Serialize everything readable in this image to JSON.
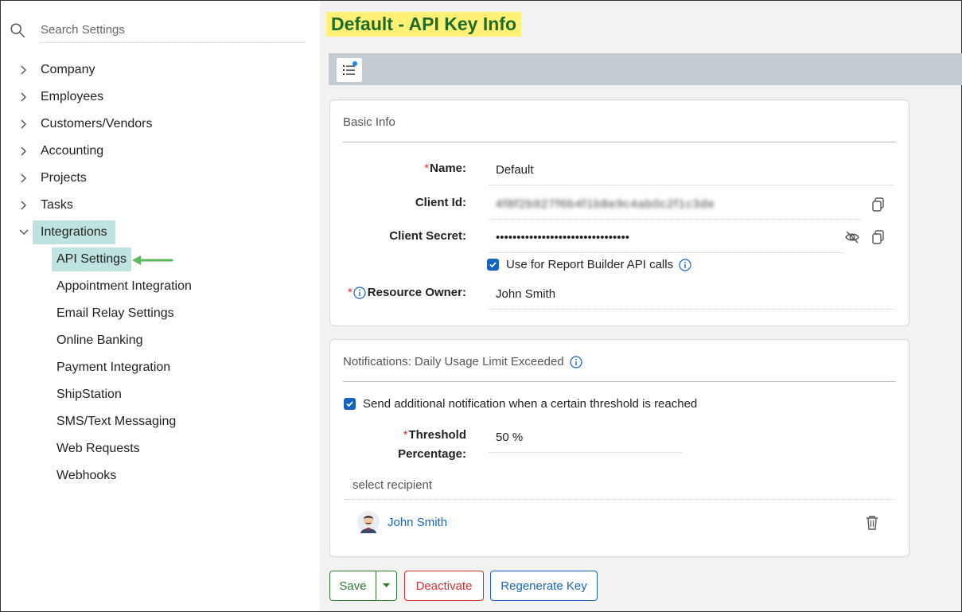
{
  "sidebar": {
    "search_placeholder": "Search Settings",
    "items": [
      {
        "label": "Company"
      },
      {
        "label": "Employees"
      },
      {
        "label": "Customers/Vendors"
      },
      {
        "label": "Accounting"
      },
      {
        "label": "Projects"
      },
      {
        "label": "Tasks"
      },
      {
        "label": "Integrations"
      }
    ],
    "sub_items": [
      {
        "label": "API Settings"
      },
      {
        "label": "Appointment Integration"
      },
      {
        "label": "Email Relay Settings"
      },
      {
        "label": "Online Banking"
      },
      {
        "label": "Payment Integration"
      },
      {
        "label": "ShipStation"
      },
      {
        "label": "SMS/Text Messaging"
      },
      {
        "label": "Web Requests"
      },
      {
        "label": "Webhooks"
      }
    ]
  },
  "page": {
    "title": "Default - API Key Info"
  },
  "basic_info": {
    "section_title": "Basic Info",
    "name_label": "Name:",
    "name_value": "Default",
    "client_id_label": "Client Id:",
    "client_id_value": "4f8f2b927f6b4f1b8e9c4ab0c2f1c3de",
    "client_secret_label": "Client Secret:",
    "client_secret_value": "••••••••••••••••••••••••••••••••",
    "report_builder_label": "Use for Report Builder API calls",
    "resource_owner_label": "Resource Owner:",
    "resource_owner_value": "John Smith"
  },
  "notifications": {
    "section_title": "Notifications: Daily Usage Limit Exceeded",
    "send_label": "Send additional notification when a certain threshold is reached",
    "threshold_label_line1": "Threshold",
    "threshold_label_line2": "Percentage:",
    "threshold_value": "50 %",
    "select_recipient": "select recipient",
    "recipient_name": "John Smith"
  },
  "actions": {
    "save": "Save",
    "deactivate": "Deactivate",
    "regenerate": "Regenerate Key"
  },
  "colors": {
    "accent": "#1565c0",
    "title_highlight": "#fff176",
    "active_nav": "#bfe3e1",
    "arrow": "#5cb85c"
  }
}
